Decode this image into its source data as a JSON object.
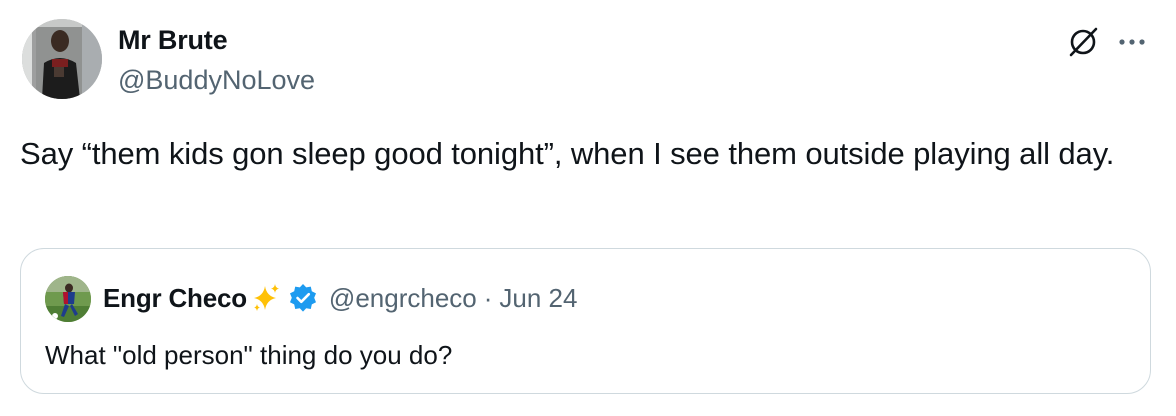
{
  "tweet": {
    "author": {
      "name": "Mr Brute",
      "handle": "@BuddyNoLove"
    },
    "text": "Say “them kids gon sleep good tonight”, when I see them outside playing all day.",
    "icons": {
      "grok": "grok-icon",
      "more": "more-icon"
    }
  },
  "quote": {
    "author": {
      "name": "Engr Checo",
      "handle": "@engrcheco",
      "separator": "·",
      "date": "Jun 24",
      "name_emoji": "sparkles-icon",
      "verified": true
    },
    "text": "What \"old person\" thing do you do?"
  },
  "colors": {
    "text_primary": "#0f1419",
    "text_secondary": "#536471",
    "border": "#cfd9de",
    "verified_blue": "#1d9bf0",
    "sparkle_yellow": "#ffc107"
  }
}
